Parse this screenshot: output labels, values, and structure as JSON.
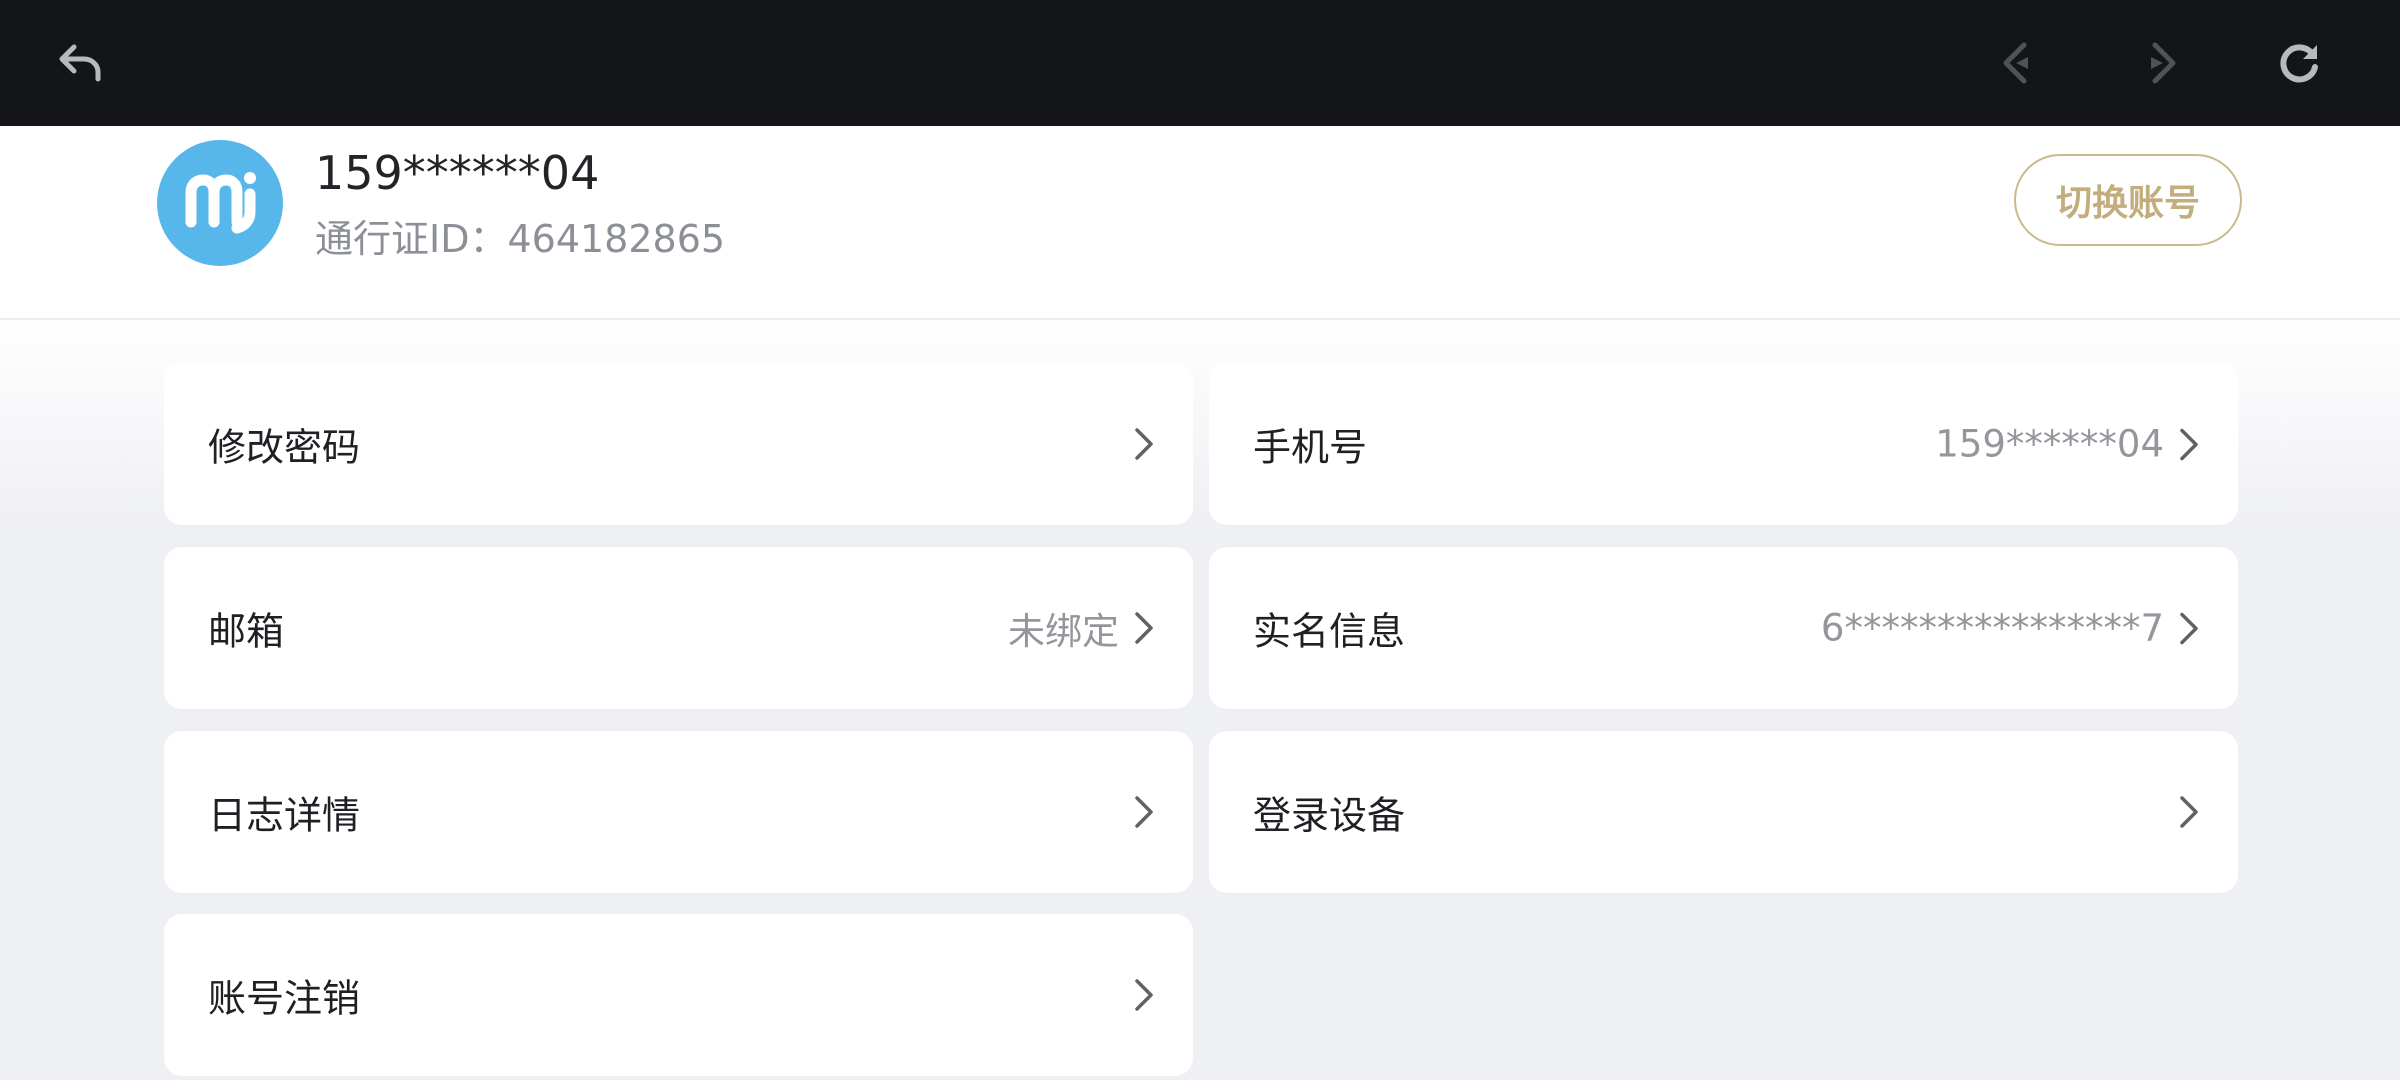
{
  "toolbar": {
    "back_icon": "back-arrow-icon",
    "prev_icon": "nav-prev-icon",
    "next_icon": "nav-next-icon",
    "refresh_icon": "refresh-icon"
  },
  "account": {
    "avatar_logo": "mi",
    "avatar_color": "#57b6ea",
    "name": "159******04",
    "passport_id": "通行证ID：464182865",
    "switch_label": "切换账号",
    "accent_color": "#c2ad7d"
  },
  "menu": [
    {
      "label": "修改密码",
      "value": ""
    },
    {
      "label": "手机号",
      "value": "159******04"
    },
    {
      "label": "邮箱",
      "value": "未绑定"
    },
    {
      "label": "实名信息",
      "value": "6****************7"
    },
    {
      "label": "日志详情",
      "value": ""
    },
    {
      "label": "登录设备",
      "value": ""
    },
    {
      "label": "账号注销",
      "value": ""
    }
  ]
}
